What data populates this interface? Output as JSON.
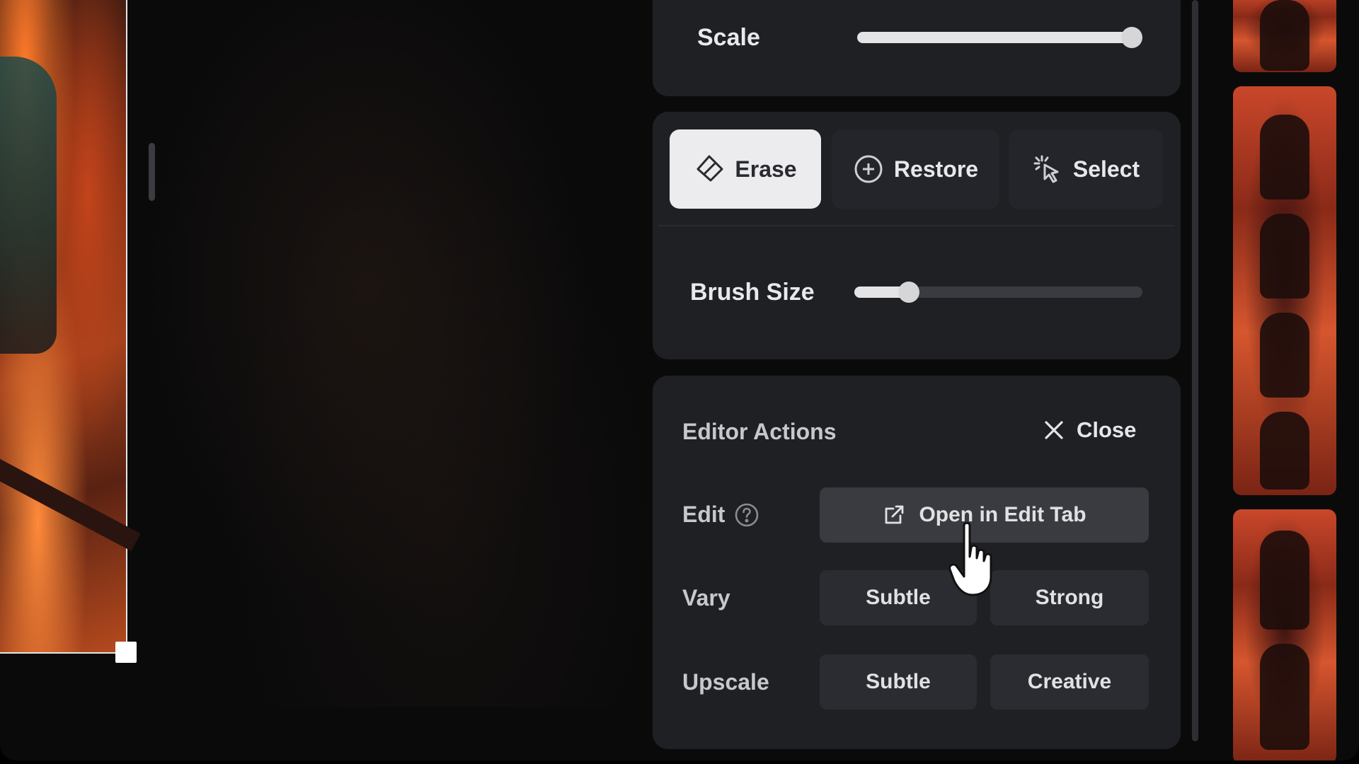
{
  "scale_panel": {
    "label": "Scale",
    "value_fraction": 0.99
  },
  "tools": {
    "items": [
      {
        "label": "Erase",
        "icon": "eraser-icon",
        "active": true
      },
      {
        "label": "Restore",
        "icon": "plus-circle-icon",
        "active": false
      },
      {
        "label": "Select",
        "icon": "cursor-sparkle-icon",
        "active": false
      }
    ],
    "brush_size_label": "Brush Size",
    "brush_size_fraction": 0.19
  },
  "editor_actions": {
    "title": "Editor Actions",
    "close_label": "Close",
    "edit_label": "Edit",
    "open_in_edit_tab_label": "Open in Edit Tab",
    "vary_label": "Vary",
    "vary_subtle_label": "Subtle",
    "vary_strong_label": "Strong",
    "upscale_label": "Upscale",
    "upscale_subtle_label": "Subtle",
    "upscale_creative_label": "Creative"
  },
  "colors": {
    "panel_bg": "#1f2024",
    "active_tool_bg": "#ececee",
    "button_bg": "#2b2c31",
    "accent_fire": "#c9472a"
  }
}
